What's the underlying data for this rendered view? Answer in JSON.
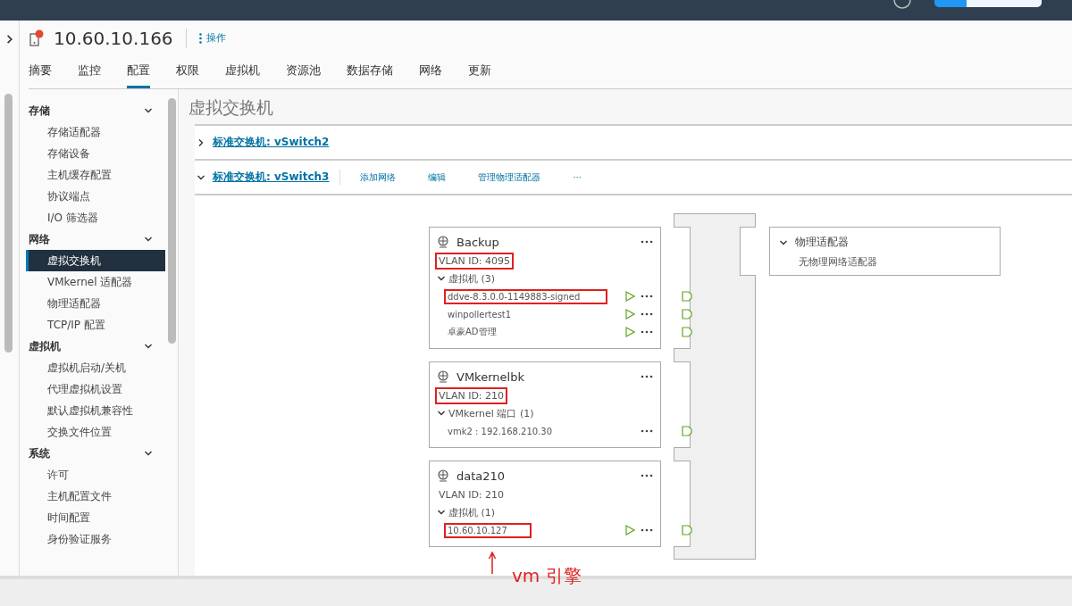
{
  "header": {
    "host": "10.60.10.166",
    "alert": true,
    "actions": "操作"
  },
  "tabs": [
    {
      "label": "摘要",
      "selected": false
    },
    {
      "label": "监控",
      "selected": false
    },
    {
      "label": "配置",
      "selected": true
    },
    {
      "label": "权限",
      "selected": false
    },
    {
      "label": "虚拟机",
      "selected": false
    },
    {
      "label": "资源池",
      "selected": false
    },
    {
      "label": "数据存储",
      "selected": false
    },
    {
      "label": "网络",
      "selected": false
    },
    {
      "label": "更新",
      "selected": false
    }
  ],
  "sidebar": [
    {
      "title": "存储",
      "expanded": true,
      "items": [
        {
          "label": "存储适配器",
          "selected": false
        },
        {
          "label": "存储设备",
          "selected": false
        },
        {
          "label": "主机缓存配置",
          "selected": false
        },
        {
          "label": "协议端点",
          "selected": false
        },
        {
          "label": "I/O 筛选器",
          "selected": false
        }
      ]
    },
    {
      "title": "网络",
      "expanded": true,
      "items": [
        {
          "label": "虚拟交换机",
          "selected": true
        },
        {
          "label": "VMkernel 适配器",
          "selected": false
        },
        {
          "label": "物理适配器",
          "selected": false
        },
        {
          "label": "TCP/IP 配置",
          "selected": false
        }
      ]
    },
    {
      "title": "虚拟机",
      "expanded": true,
      "items": [
        {
          "label": "虚拟机启动/关机",
          "selected": false
        },
        {
          "label": "代理虚拟机设置",
          "selected": false
        },
        {
          "label": "默认虚拟机兼容性",
          "selected": false
        },
        {
          "label": "交换文件位置",
          "selected": false
        }
      ]
    },
    {
      "title": "系统",
      "expanded": true,
      "items": [
        {
          "label": "许可",
          "selected": false
        },
        {
          "label": "主机配置文件",
          "selected": false
        },
        {
          "label": "时间配置",
          "selected": false
        },
        {
          "label": "身份验证服务",
          "selected": false
        }
      ]
    }
  ],
  "page_title": "虚拟交换机",
  "switches": [
    {
      "name": "标准交换机: vSwitch2",
      "expanded": false
    },
    {
      "name": "标准交换机: vSwitch3",
      "expanded": true,
      "actions": [
        "添加网络",
        "编辑",
        "管理物理适配器"
      ],
      "more": "···"
    }
  ],
  "port_groups": [
    {
      "name": "Backup",
      "vlan": "VLAN ID: 4095",
      "vlan_highlighted": true,
      "group": {
        "kind": "vm",
        "label": "虚拟机 (3)",
        "expanded": true
      },
      "items": [
        {
          "name": "ddve-8.3.0.0-1149883-signed",
          "highlighted": true
        },
        {
          "name": "winpollertest1",
          "highlighted": false
        },
        {
          "name": "卓豪AD管理",
          "highlighted": false
        }
      ]
    },
    {
      "name": "VMkernelbk",
      "vlan": "VLAN ID: 210",
      "vlan_highlighted": true,
      "group": {
        "kind": "vmkernel",
        "label": "VMkernel 端口 (1)",
        "expanded": true
      },
      "items": [
        {
          "name": "vmk2 : 192.168.210.30",
          "highlighted": false
        }
      ]
    },
    {
      "name": "data210",
      "vlan": "VLAN ID: 210",
      "vlan_highlighted": false,
      "group": {
        "kind": "vm",
        "label": "虚拟机 (1)",
        "expanded": true
      },
      "items": [
        {
          "name": "10.60.10.127",
          "highlighted": true
        }
      ]
    }
  ],
  "physical_adapters": {
    "title": "物理适配器",
    "expanded": true,
    "empty_text": "无物理网络适配器"
  },
  "annotation": {
    "text": "vm 引擎"
  }
}
